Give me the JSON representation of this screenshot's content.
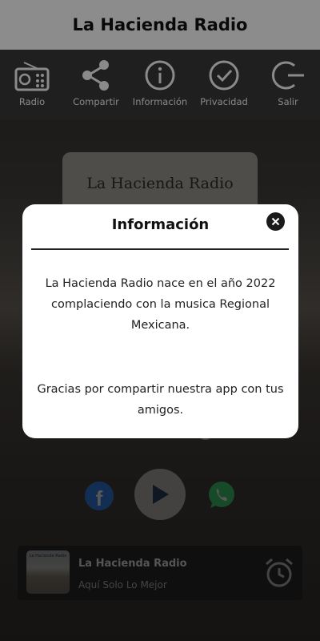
{
  "header": {
    "title": "La Hacienda Radio"
  },
  "toolbar": {
    "items": [
      {
        "label": "Radio",
        "icon": "radio-icon"
      },
      {
        "label": "Compartir",
        "icon": "share-icon"
      },
      {
        "label": "Información",
        "icon": "info-icon"
      },
      {
        "label": "Privacidad",
        "icon": "check-circle-icon"
      },
      {
        "label": "Salir",
        "icon": "exit-icon"
      }
    ]
  },
  "logo_card": {
    "text": "La Hacienda Radio"
  },
  "now_playing": {
    "title": "La Hacienda Radio",
    "subtitle": "Aquí Solo Lo Mejor",
    "thumb_text": "La Hacienda Radio"
  },
  "modal": {
    "title": "Información",
    "paragraph1": "La Hacienda Radio nace en el año 2022 complaciendo con la musica Regional Mexicana.",
    "paragraph2": "Gracias por compartir nuestra app con tus amigos."
  },
  "colors": {
    "toolbar_bg": "#1f1f1f",
    "toolbar_label": "#8a8a8a",
    "facebook": "#1877f2",
    "whatsapp": "#25d366",
    "modal_bg": "#ffffff"
  }
}
